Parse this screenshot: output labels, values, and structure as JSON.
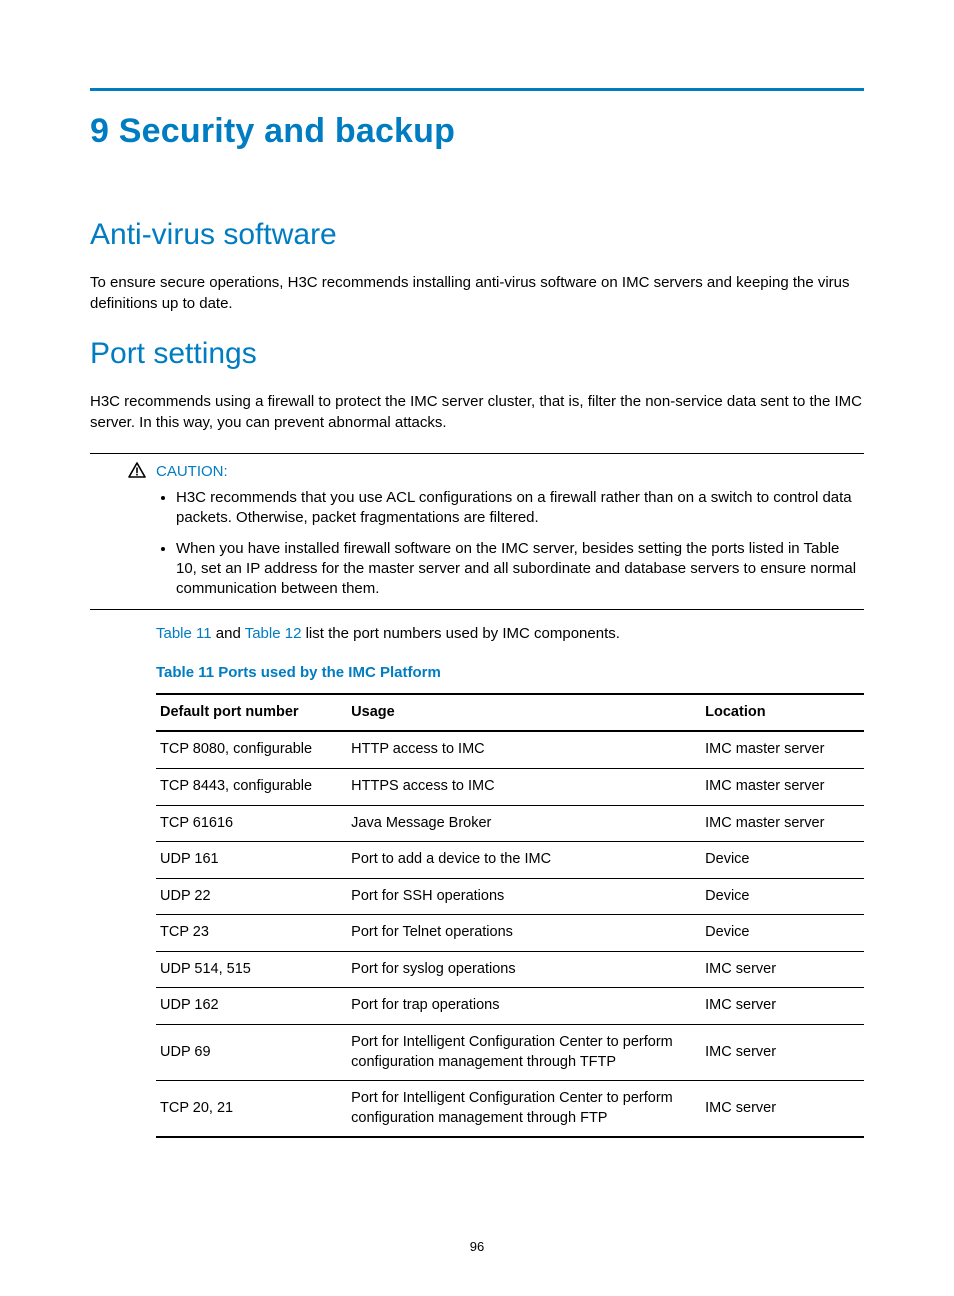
{
  "chapter": {
    "title": "9 Security and backup"
  },
  "section1": {
    "heading": "Anti-virus software",
    "para": "To ensure secure operations, H3C recommends installing anti-virus software on IMC servers and keeping the virus definitions up to date."
  },
  "section2": {
    "heading": "Port settings",
    "para": "H3C recommends using a firewall to protect the IMC server cluster, that is, filter the non-service data sent to the IMC server. In this way, you can prevent abnormal attacks."
  },
  "caution": {
    "label": "CAUTION:",
    "items": [
      "H3C recommends that you use ACL configurations on a firewall rather than on a switch to control data packets. Otherwise, packet fragmentations are filtered.",
      "When you have installed firewall software on the IMC server, besides setting the ports listed in Table 10, set an IP address for the master server and all subordinate and database servers to ensure normal communication between them."
    ]
  },
  "intro_line": {
    "link1": "Table 11",
    "mid": " and ",
    "link2": "Table 12",
    "tail": " list the port numbers used by IMC components."
  },
  "table": {
    "caption": "Table 11 Ports used by the IMC Platform",
    "headers": {
      "c1": "Default port number",
      "c2": "Usage",
      "c3": "Location"
    },
    "rows": [
      {
        "c1": "TCP 8080, configurable",
        "c2": "HTTP access to IMC",
        "c3": "IMC master server"
      },
      {
        "c1": "TCP 8443, configurable",
        "c2": "HTTPS access to IMC",
        "c3": "IMC master server"
      },
      {
        "c1": "TCP 61616",
        "c2": "Java Message Broker",
        "c3": "IMC master server"
      },
      {
        "c1": "UDP 161",
        "c2": "Port to add a device to the IMC",
        "c3": "Device"
      },
      {
        "c1": "UDP 22",
        "c2": "Port for SSH operations",
        "c3": "Device"
      },
      {
        "c1": "TCP 23",
        "c2": "Port for Telnet operations",
        "c3": "Device"
      },
      {
        "c1": "UDP 514, 515",
        "c2": "Port for syslog operations",
        "c3": "IMC server"
      },
      {
        "c1": "UDP 162",
        "c2": "Port for trap operations",
        "c3": "IMC server"
      },
      {
        "c1": "UDP 69",
        "c2": "Port for Intelligent Configuration Center to perform configuration management through TFTP",
        "c3": "IMC server"
      },
      {
        "c1": "TCP 20, 21",
        "c2": "Port for Intelligent Configuration Center to perform configuration management through FTP",
        "c3": "IMC server"
      }
    ]
  },
  "page_number": "96"
}
